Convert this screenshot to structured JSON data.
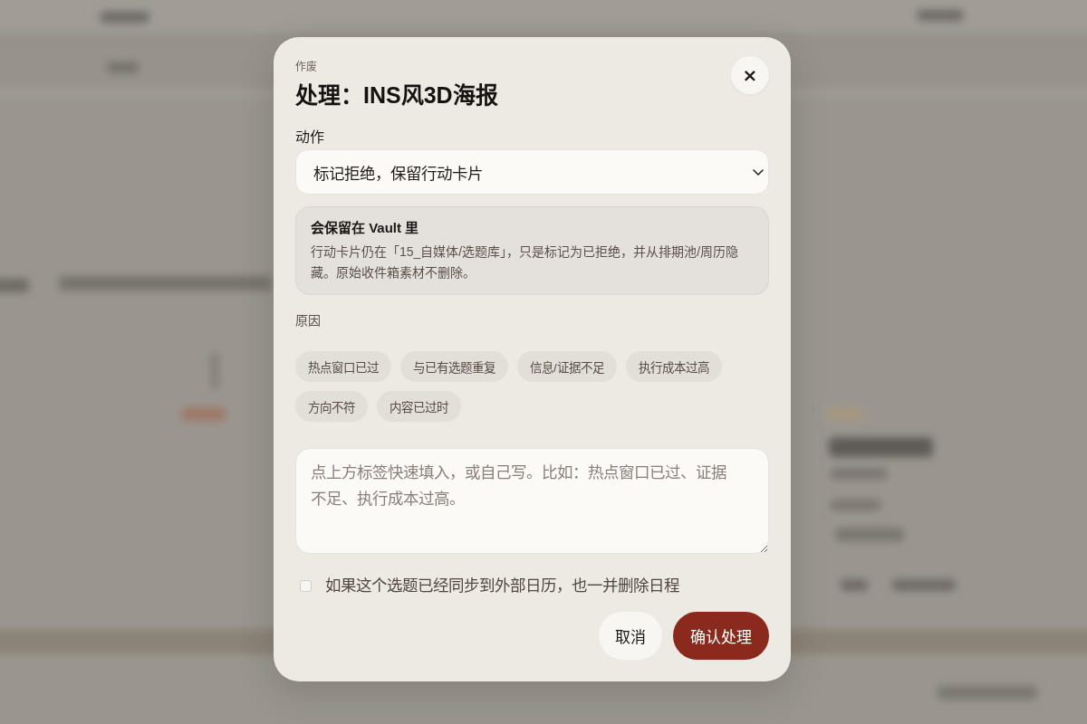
{
  "dialog": {
    "eyebrow": "作废",
    "title": "处理：INS风3D海报",
    "close": "×"
  },
  "action": {
    "label": "动作",
    "value": "标记拒绝，保留行动卡片"
  },
  "notice": {
    "title": "会保留在 Vault 里",
    "body": "行动卡片仍在「15_自媒体/选题库」，只是标记为已拒绝，并从排期池/周历隐藏。原始收件箱素材不删除。"
  },
  "reason": {
    "label": "原因",
    "tags": [
      "热点窗口已过",
      "与已有选题重复",
      "信息/证据不足",
      "执行成本过高",
      "方向不符",
      "内容已过时"
    ],
    "placeholder": "点上方标签快速填入，或自己写。比如：热点窗口已过、证据不足、执行成本过高。"
  },
  "calendar_option": {
    "label": "如果这个选题已经同步到外部日历，也一并删除日程",
    "checked": false
  },
  "buttons": [
    {
      "label": "取消",
      "kind": "secondary"
    },
    {
      "label": "确认处理",
      "kind": "primary"
    }
  ]
}
